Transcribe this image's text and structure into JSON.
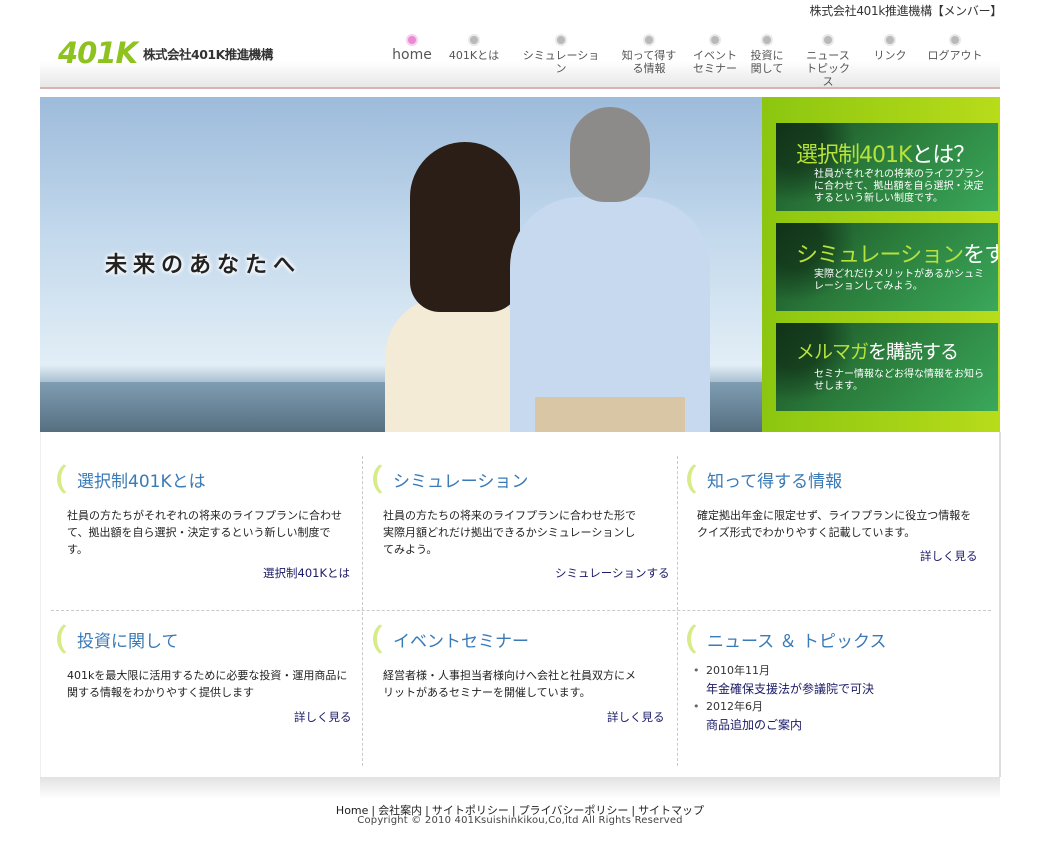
{
  "topline": "株式会社401k推進機構【メンバー】",
  "logo": {
    "mark": "401K",
    "company": "株式会社401K推進機構"
  },
  "nav": [
    {
      "label": "home"
    },
    {
      "label": "401Kとは"
    },
    {
      "label": "シミュレーション"
    },
    {
      "label": "知って得する情報"
    },
    {
      "label": "イベントセミナー"
    },
    {
      "label": "投資に関して"
    },
    {
      "label": "ニューストピックス"
    },
    {
      "label": "リンク"
    },
    {
      "label": "ログアウト"
    }
  ],
  "hero": {
    "tagline": "未来のあなたへ",
    "promos": [
      {
        "title_a": "選択制401K",
        "title_b": "とは？",
        "desc": "社員がそれぞれの将来のライフプランに合わせて、拠出額を自ら選択・決定するという新しい制度です。"
      },
      {
        "title_a": "シミュレーション",
        "title_b": "をする",
        "desc": "実際どれだけメリットがあるかシュミレーションしてみよう。"
      },
      {
        "title_a": "メルマガ",
        "title_b": "を購読する",
        "desc": "セミナー情報などお得な情報をお知らせします。"
      }
    ]
  },
  "sections": [
    {
      "title": "選択制401Kとは",
      "desc": "社員の方たちがそれぞれの将来のライフプランに合わせて、拠出額を自ら選択・決定するという新しい制度です。",
      "link": "選択制401Kとは"
    },
    {
      "title": "シミュレーション",
      "desc": "社員の方たちの将来のライフプランに合わせた形で実際月額どれだけ拠出できるかシミュレーションしてみよう。",
      "link": "シミュレーションする"
    },
    {
      "title": "知って得する情報",
      "desc": "確定拠出年金に限定せず、ライフプランに役立つ情報をクイズ形式でわかりやすく記載しています。",
      "link": "詳しく見る"
    },
    {
      "title": "投資に関して",
      "desc": "401kを最大限に活用するために必要な投資・運用商品に関する情報をわかりやすく提供します",
      "link": "詳しく見る"
    },
    {
      "title": "イベントセミナー",
      "desc": "経営者様・人事担当者様向けへ会社と社員双方にメリットがあるセミナーを開催しています。",
      "link": "詳しく見る"
    },
    {
      "title": "ニュース ＆ トピックス"
    }
  ],
  "news": [
    {
      "date": "2010年11月",
      "title": "年金確保支援法が参議院で可決"
    },
    {
      "date": "2012年6月",
      "title": "商品追加のご案内"
    }
  ],
  "footer": {
    "links": [
      "Home",
      "会社案内",
      "サイトポリシー",
      "プライバシーポリシー",
      "サイトマップ"
    ],
    "copyright": "Copyright © 2010 401Ksuishinkikou,Co,ltd All Rights Reserved"
  }
}
